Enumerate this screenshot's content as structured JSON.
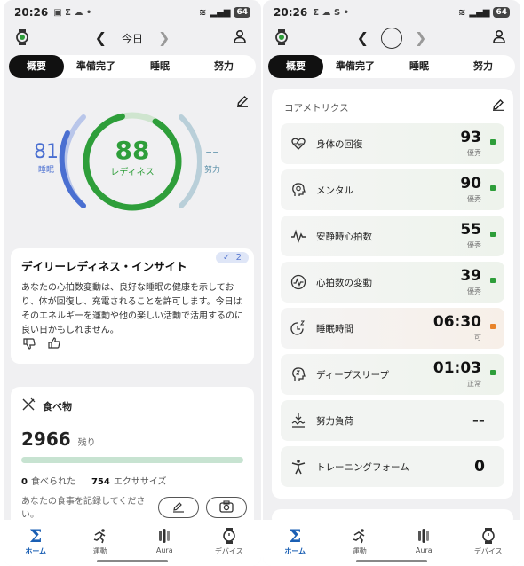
{
  "left": {
    "status": {
      "time": "20:26",
      "battery": "64"
    },
    "nav": {
      "date": "今日"
    },
    "tabs": [
      "概要",
      "準備完了",
      "睡眠",
      "努力"
    ],
    "readiness": {
      "sleep_value": "81",
      "sleep_label": "睡眠",
      "score": "88",
      "score_label": "レディネス",
      "effort_value": "--",
      "effort_label": "努力",
      "score_fraction": 0.88
    },
    "insight": {
      "title": "デイリーレディネス・インサイト",
      "badge": "2",
      "body": "あなたの心拍数変動は、良好な睡眠の健康を示しており、体が回復し、充電されることを許可します。今日はそのエネルギーを運動や他の楽しい活動で活用するのに良い日かもしれません。"
    },
    "food": {
      "title": "食べ物",
      "remaining": "2966",
      "remaining_label": "残り",
      "eaten_value": "0",
      "eaten_label": "食べられた",
      "exercise_value": "754",
      "exercise_label": "エクササイズ",
      "prompt": "あなたの食事を記録してください。"
    }
  },
  "right": {
    "status": {
      "time": "20:26",
      "battery": "64"
    },
    "tabs": [
      "概要",
      "準備完了",
      "睡眠",
      "努力"
    ],
    "core_title": "コアメトリクス",
    "metrics": [
      {
        "label": "身体の回復",
        "value": "93",
        "status": "優秀",
        "icon": "heart-pulse-icon"
      },
      {
        "label": "メンタル",
        "value": "90",
        "status": "優秀",
        "icon": "head-brain-icon"
      },
      {
        "label": "安静時心拍数",
        "value": "55",
        "status": "優秀",
        "icon": "pulse-wave-icon"
      },
      {
        "label": "心拍数の変動",
        "value": "39",
        "status": "優秀",
        "icon": "heart-rate-circle-icon"
      },
      {
        "label": "睡眠時間",
        "value": "06:30",
        "status": "可",
        "icon": "sleep-clock-icon"
      },
      {
        "label": "ディープスリープ",
        "value": "01:03",
        "status": "正常",
        "icon": "deep-sleep-head-icon"
      },
      {
        "label": "努力負荷",
        "value": "--",
        "status": "",
        "icon": "effort-load-icon"
      },
      {
        "label": "トレーニングフォーム",
        "value": "0",
        "status": "",
        "icon": "training-form-icon"
      }
    ]
  },
  "bottom_nav": [
    {
      "label": "ホーム",
      "icon": "sigma-icon"
    },
    {
      "label": "運動",
      "icon": "run-icon"
    },
    {
      "label": "Aura",
      "icon": "aura-icon"
    },
    {
      "label": "デバイス",
      "icon": "watch-icon"
    }
  ],
  "colors": {
    "green": "#2e9e3a",
    "blue": "#4a6fd1",
    "teal": "#5a8fa8",
    "orange": "#e8832a",
    "accent_nav": "#1a5fb4"
  }
}
